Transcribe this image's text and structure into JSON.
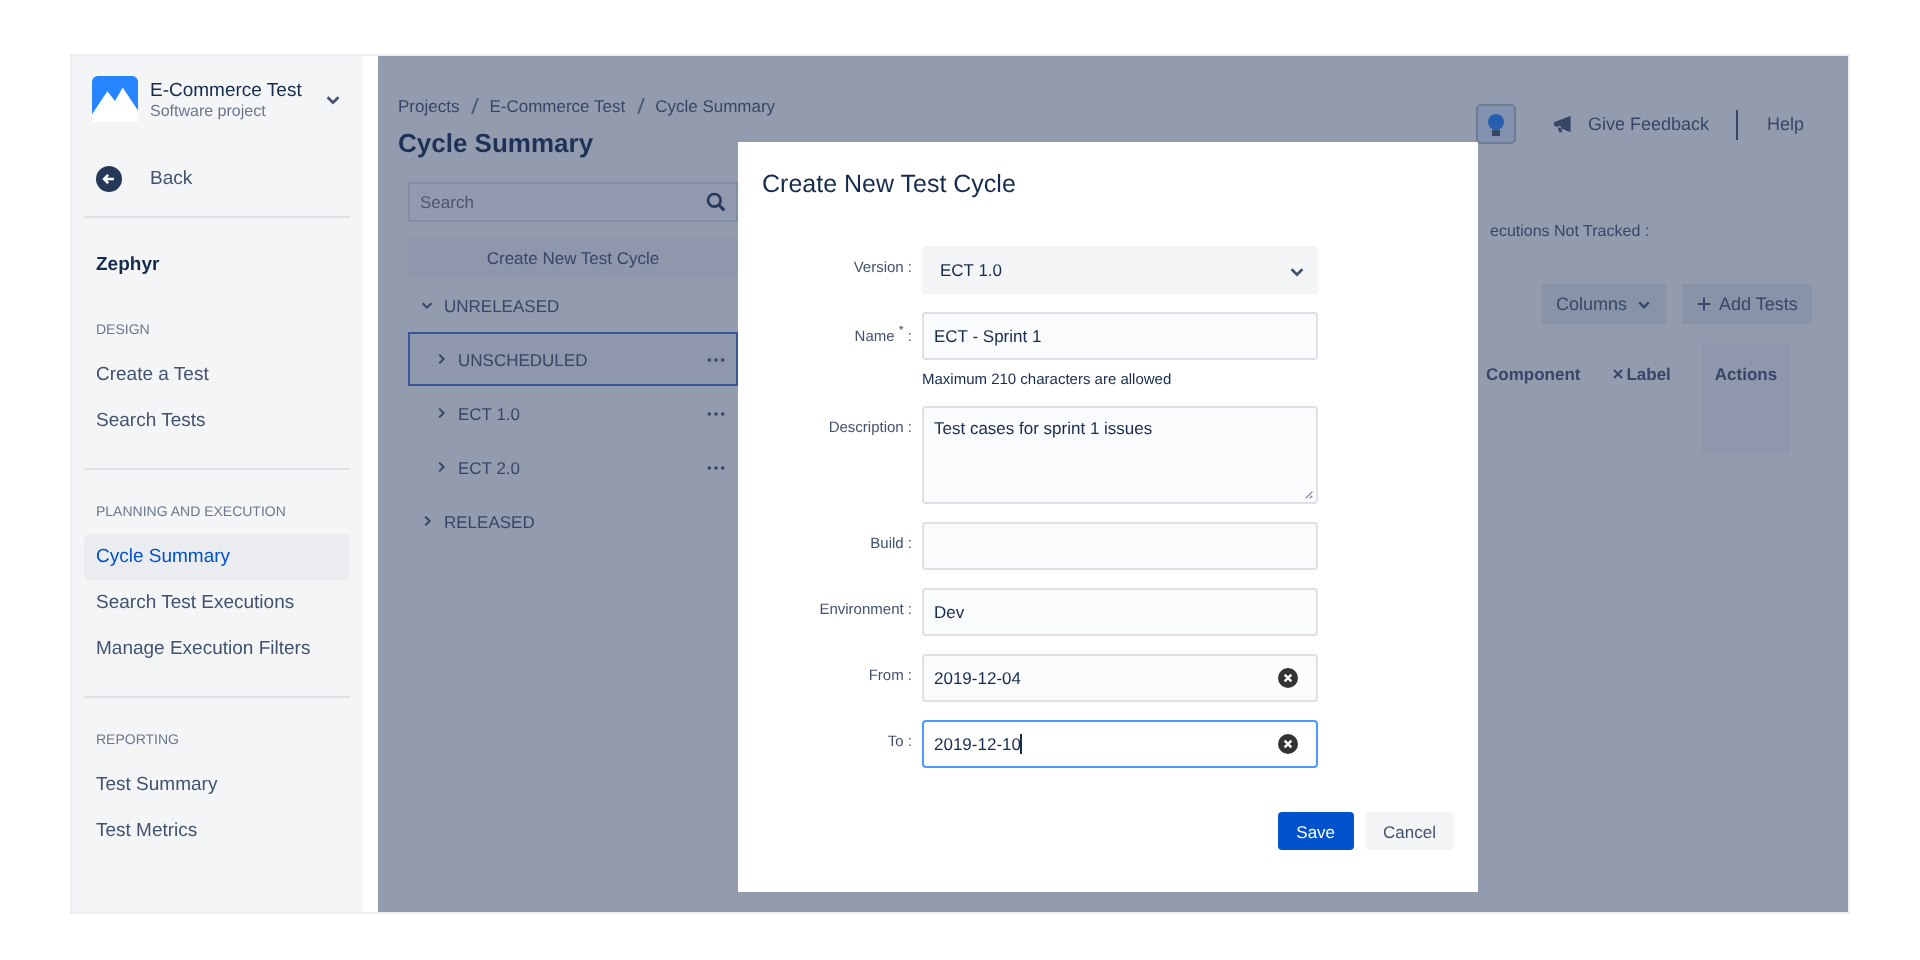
{
  "sidebar": {
    "project": {
      "name": "E-Commerce Test",
      "type": "Software project"
    },
    "back": "Back",
    "app_name": "Zephyr",
    "groups": [
      {
        "heading": "DESIGN",
        "items": [
          {
            "label": "Create a Test",
            "selected": false
          },
          {
            "label": "Search Tests",
            "selected": false
          }
        ]
      },
      {
        "heading": "PLANNING AND EXECUTION",
        "items": [
          {
            "label": "Cycle Summary",
            "selected": true
          },
          {
            "label": "Search Test Executions",
            "selected": false
          },
          {
            "label": "Manage Execution Filters",
            "selected": false
          }
        ]
      },
      {
        "heading": "REPORTING",
        "items": [
          {
            "label": "Test Summary",
            "selected": false
          },
          {
            "label": "Test Metrics",
            "selected": false
          }
        ]
      }
    ]
  },
  "header": {
    "breadcrumbs": [
      "Projects",
      "E-Commerce Test",
      "Cycle Summary"
    ],
    "title": "Cycle Summary",
    "feedback": "Give Feedback",
    "help": "Help"
  },
  "cycles": {
    "search": {
      "placeholder": "Search"
    },
    "create_button": "Create New Test Cycle",
    "tree": [
      {
        "label": "UNRELEASED",
        "expanded": true,
        "selected": false,
        "children": [
          {
            "label": "UNSCHEDULED",
            "expanded": false,
            "selected": true
          },
          {
            "label": "ECT 1.0",
            "expanded": false,
            "selected": false
          },
          {
            "label": "ECT 2.0",
            "expanded": false,
            "selected": false
          }
        ]
      },
      {
        "label": "RELEASED",
        "expanded": false,
        "selected": false
      }
    ]
  },
  "detail": {
    "summary": "ecutions Not Tracked :",
    "columns_button": "Columns",
    "add_button": "Add Tests",
    "table": {
      "columns": [
        "Component",
        "Label",
        "Actions"
      ]
    }
  },
  "modal": {
    "title": "Create New Test Cycle",
    "fields": [
      {
        "kind": "select",
        "label": "Version :",
        "value": "ECT 1.0"
      },
      {
        "kind": "text",
        "label": "Name $^{*}$ :",
        "value": "ECT - Sprint 1",
        "hint": "Maximum 210 characters are allowed"
      },
      {
        "kind": "textarea",
        "label": "Description :",
        "value": "Test cases for sprint 1 issues"
      },
      {
        "kind": "text",
        "label": "Build :"
      },
      {
        "kind": "text",
        "label": "Environment :",
        "value": "Dev"
      },
      {
        "kind": "date",
        "label": "From :",
        "value": "2019-12-04",
        "focused": false
      },
      {
        "kind": "date",
        "label": "To :",
        "value": "2019-12-10",
        "focused": true
      }
    ],
    "buttons": [
      {
        "label": "Save",
        "kind": "primary"
      },
      {
        "label": "Cancel",
        "kind": "secondary"
      }
    ]
  }
}
